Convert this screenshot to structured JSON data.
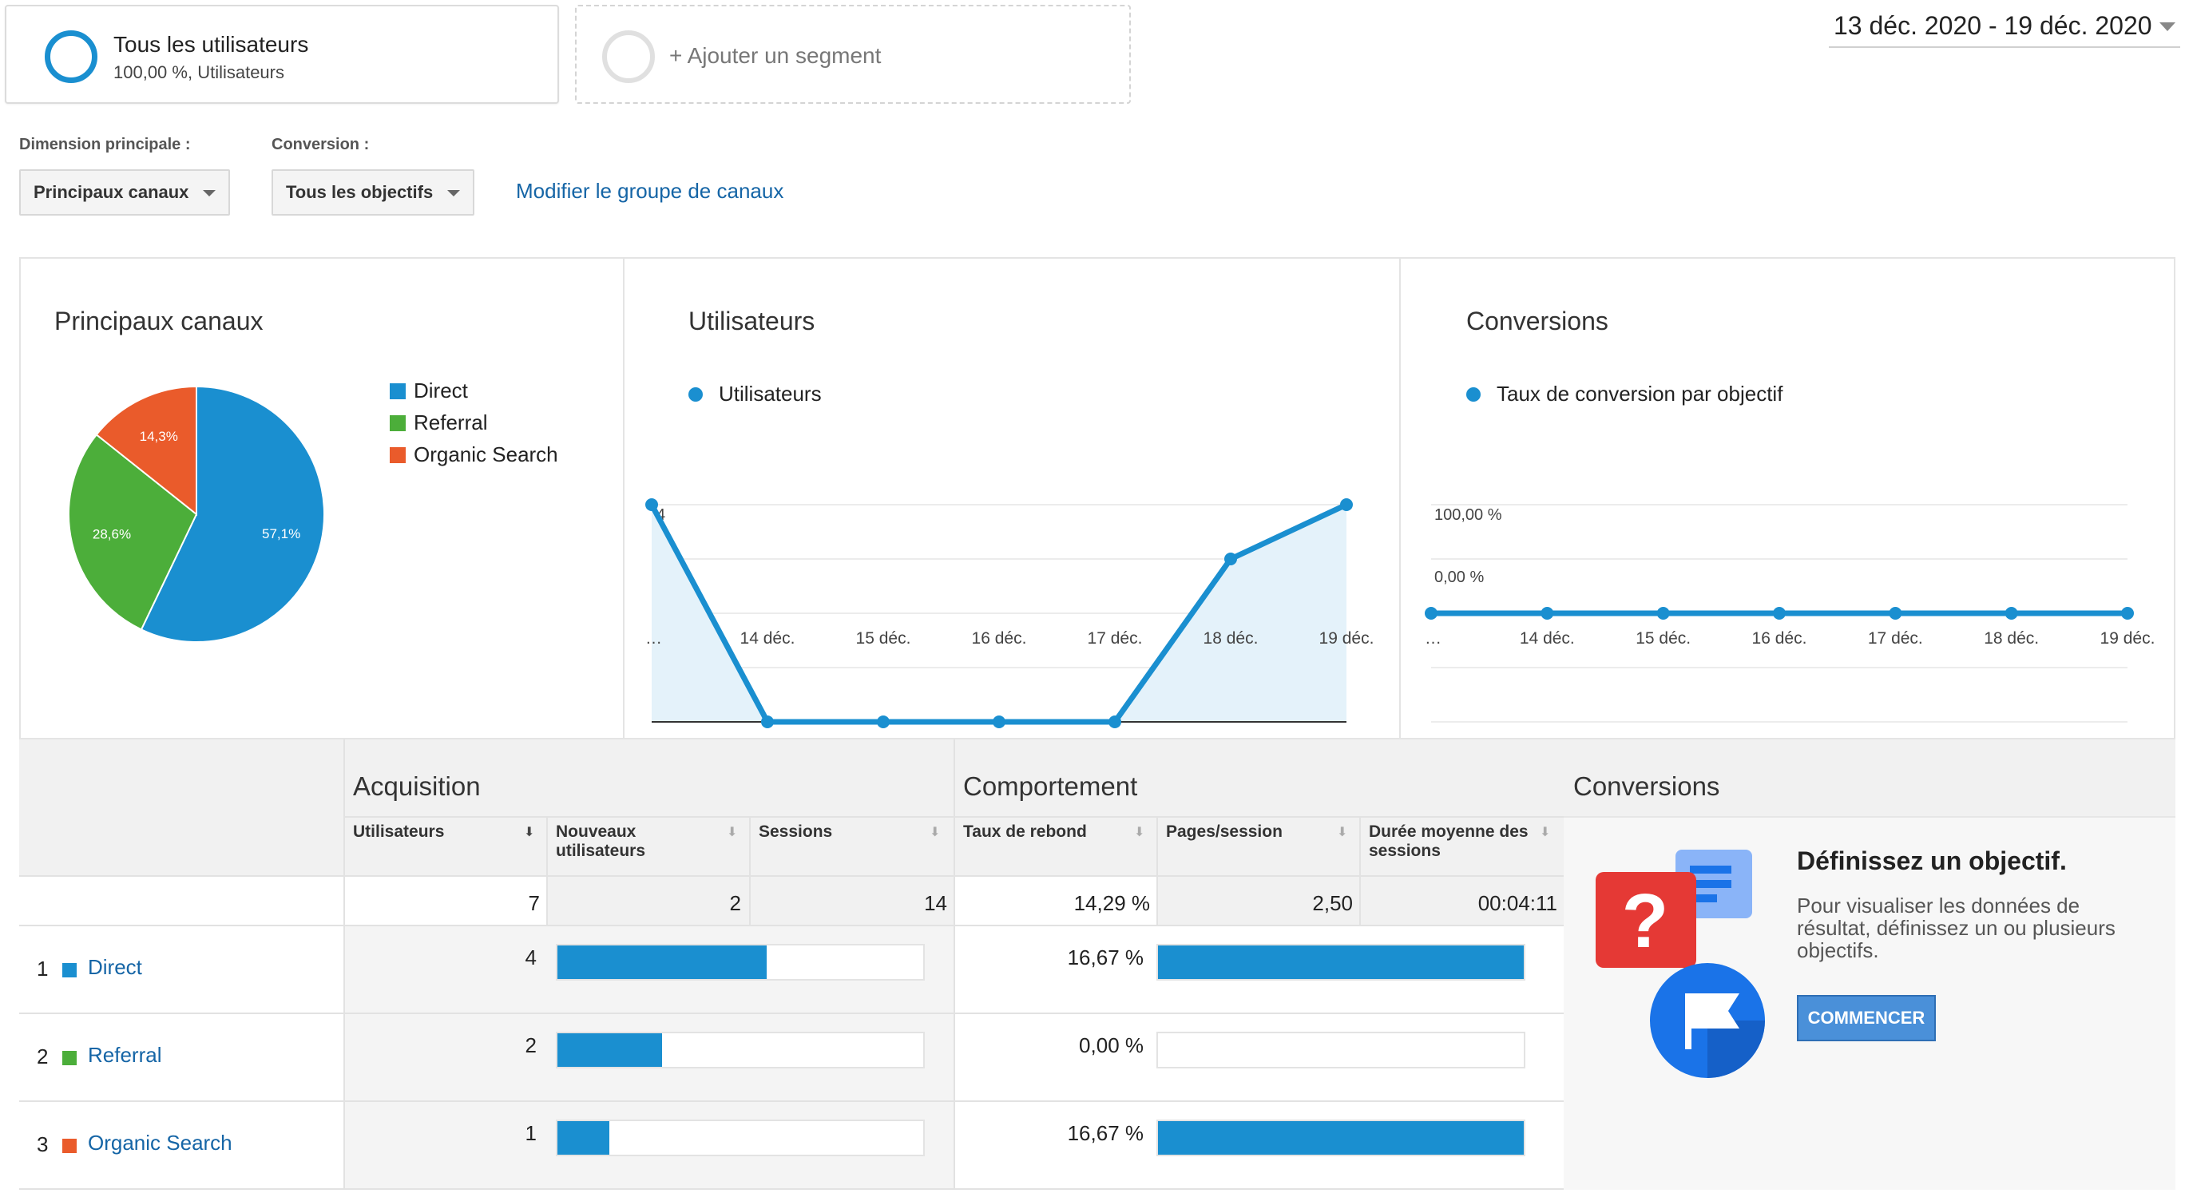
{
  "segments": {
    "active": {
      "title": "Tous les utilisateurs",
      "subtitle": "100,00 %, Utilisateurs"
    },
    "add_label": "+ Ajouter un segment"
  },
  "date_range": "13 déc. 2020 - 19 déc. 2020",
  "filters": {
    "dimension_label": "Dimension principale :",
    "dimension_value": "Principaux canaux",
    "conversion_label": "Conversion :",
    "conversion_value": "Tous les objectifs",
    "edit_link": "Modifier le groupe de canaux"
  },
  "colors": {
    "direct": "#1a8fd0",
    "referral": "#4cae3a",
    "organic": "#ea5b2b",
    "accent": "#1a8fd0"
  },
  "channels_panel": {
    "title": "Principaux canaux",
    "legend": [
      "Direct",
      "Referral",
      "Organic Search"
    ]
  },
  "users_panel": {
    "title": "Utilisateurs",
    "legend": "Utilisateurs"
  },
  "conversions_panel": {
    "title": "Conversions",
    "legend": "Taux de conversion par objectif"
  },
  "chart_data": [
    {
      "type": "pie",
      "title": "Principaux canaux",
      "categories": [
        "Direct",
        "Referral",
        "Organic Search"
      ],
      "values": [
        57.1,
        28.6,
        14.3
      ],
      "labels": [
        "57,1%",
        "28,6%",
        "14,3%"
      ]
    },
    {
      "type": "area",
      "title": "Utilisateurs",
      "x": [
        "…",
        "14 déc.",
        "15 déc.",
        "16 déc.",
        "17 déc.",
        "18 déc.",
        "19 déc."
      ],
      "series": [
        {
          "name": "Utilisateurs",
          "values": [
            4,
            0,
            0,
            0,
            0,
            3,
            4
          ]
        }
      ],
      "yticks": [
        "4",
        "2"
      ],
      "ylim": [
        0,
        4
      ]
    },
    {
      "type": "line",
      "title": "Conversions",
      "x": [
        "…",
        "14 déc.",
        "15 déc.",
        "16 déc.",
        "17 déc.",
        "18 déc.",
        "19 déc."
      ],
      "series": [
        {
          "name": "Taux de conversion par objectif",
          "values": [
            0,
            0,
            0,
            0,
            0,
            0,
            0
          ]
        }
      ],
      "yticks": [
        "100,00 %",
        "0,00 %"
      ],
      "ylim": [
        -100,
        100
      ]
    }
  ],
  "table": {
    "groups": {
      "acquisition": "Acquisition",
      "behavior": "Comportement",
      "conversions": "Conversions"
    },
    "headers": {
      "users": "Utilisateurs",
      "new_users": "Nouveaux utilisateurs",
      "sessions": "Sessions",
      "bounce": "Taux de rebond",
      "pages": "Pages/session",
      "duration": "Durée moyenne des sessions"
    },
    "totals": {
      "users": "7",
      "new_users": "2",
      "sessions": "14",
      "bounce": "14,29 %",
      "pages": "2,50",
      "duration": "00:04:11"
    },
    "rows": [
      {
        "num": "1",
        "channel": "Direct",
        "users": "4",
        "users_share": 0.571,
        "bounce": "16,67 %",
        "bounce_share": 1.0
      },
      {
        "num": "2",
        "channel": "Referral",
        "users": "2",
        "users_share": 0.286,
        "bounce": "0,00 %",
        "bounce_share": 0.0
      },
      {
        "num": "3",
        "channel": "Organic Search",
        "users": "1",
        "users_share": 0.143,
        "bounce": "16,67 %",
        "bounce_share": 1.0
      }
    ]
  },
  "promo": {
    "heading": "Définissez un objectif.",
    "text": "Pour visualiser les données de résultat, définissez un ou plusieurs objectifs.",
    "button": "COMMENCER"
  }
}
